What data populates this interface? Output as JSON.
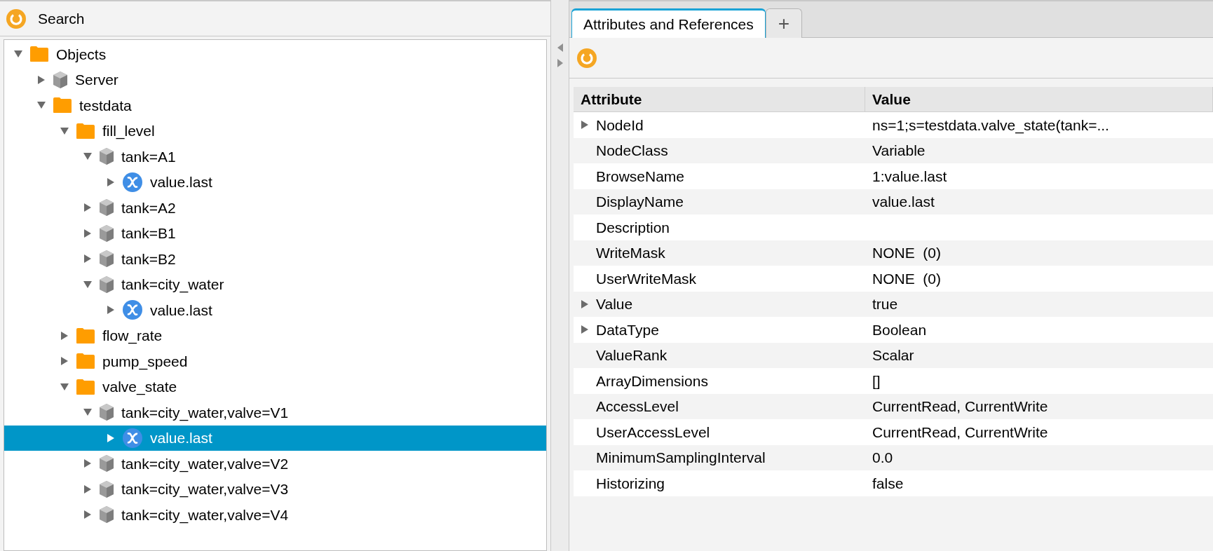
{
  "search_panel": {
    "title": "Search"
  },
  "tree": [
    {
      "label": "Objects",
      "kind": "folder",
      "expanded": true,
      "selected": false,
      "children": [
        {
          "label": "Server",
          "kind": "object",
          "expanded": false,
          "selected": false
        },
        {
          "label": "testdata",
          "kind": "folder",
          "expanded": true,
          "selected": false,
          "children": [
            {
              "label": "fill_level",
              "kind": "folder",
              "expanded": true,
              "selected": false,
              "children": [
                {
                  "label": "tank=A1",
                  "kind": "object",
                  "expanded": true,
                  "selected": false,
                  "children": [
                    {
                      "label": "value.last",
                      "kind": "variable",
                      "expanded": false,
                      "selected": false
                    }
                  ]
                },
                {
                  "label": "tank=A2",
                  "kind": "object",
                  "expanded": false,
                  "selected": false
                },
                {
                  "label": "tank=B1",
                  "kind": "object",
                  "expanded": false,
                  "selected": false
                },
                {
                  "label": "tank=B2",
                  "kind": "object",
                  "expanded": false,
                  "selected": false
                },
                {
                  "label": "tank=city_water",
                  "kind": "object",
                  "expanded": true,
                  "selected": false,
                  "children": [
                    {
                      "label": "value.last",
                      "kind": "variable",
                      "expanded": false,
                      "selected": false
                    }
                  ]
                }
              ]
            },
            {
              "label": "flow_rate",
              "kind": "folder",
              "expanded": false,
              "selected": false
            },
            {
              "label": "pump_speed",
              "kind": "folder",
              "expanded": false,
              "selected": false
            },
            {
              "label": "valve_state",
              "kind": "folder",
              "expanded": true,
              "selected": false,
              "children": [
                {
                  "label": "tank=city_water,valve=V1",
                  "kind": "object",
                  "expanded": true,
                  "selected": false,
                  "children": [
                    {
                      "label": "value.last",
                      "kind": "variable",
                      "expanded": false,
                      "selected": true
                    }
                  ]
                },
                {
                  "label": "tank=city_water,valve=V2",
                  "kind": "object",
                  "expanded": false,
                  "selected": false
                },
                {
                  "label": "tank=city_water,valve=V3",
                  "kind": "object",
                  "expanded": false,
                  "selected": false
                },
                {
                  "label": "tank=city_water,valve=V4",
                  "kind": "object",
                  "expanded": false,
                  "selected": false
                }
              ]
            }
          ]
        }
      ]
    }
  ],
  "tabs": [
    {
      "label": "Attributes and References",
      "kind": "tab",
      "selected": true
    },
    {
      "label": "+",
      "kind": "add",
      "selected": false
    }
  ],
  "table": {
    "columns": [
      "Attribute",
      "Value"
    ],
    "rows": [
      {
        "attribute": "NodeId",
        "value": "ns=1;s=testdata.valve_state(tank=...",
        "expandable": true
      },
      {
        "attribute": "NodeClass",
        "value": "Variable",
        "expandable": false
      },
      {
        "attribute": "BrowseName",
        "value": "1:value.last",
        "expandable": false
      },
      {
        "attribute": "DisplayName",
        "value": "value.last",
        "expandable": false
      },
      {
        "attribute": "Description",
        "expandable": false
      },
      {
        "attribute": "WriteMask",
        "value": "NONE  (0)",
        "expandable": false
      },
      {
        "attribute": "UserWriteMask",
        "value": "NONE  (0)",
        "expandable": false
      },
      {
        "attribute": "Value",
        "value": "true",
        "expandable": true
      },
      {
        "attribute": "DataType",
        "value": "Boolean",
        "expandable": true
      },
      {
        "attribute": "ValueRank",
        "value": "Scalar",
        "expandable": false
      },
      {
        "attribute": "ArrayDimensions",
        "value": "[]",
        "expandable": false
      },
      {
        "attribute": "AccessLevel",
        "value": "CurrentRead, CurrentWrite",
        "expandable": false
      },
      {
        "attribute": "UserAccessLevel",
        "value": "CurrentRead, CurrentWrite",
        "expandable": false
      },
      {
        "attribute": "MinimumSamplingInterval",
        "value": "0.0",
        "expandable": false
      },
      {
        "attribute": "Historizing",
        "value": "false",
        "expandable": false
      }
    ]
  }
}
